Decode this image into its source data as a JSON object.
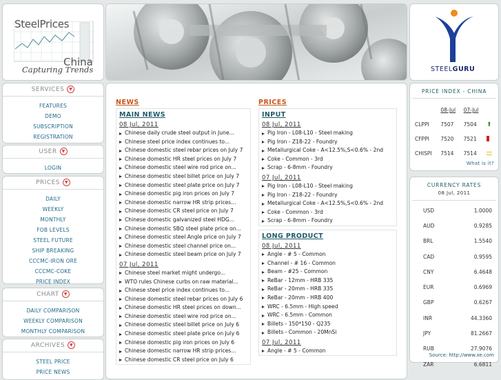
{
  "logo": {
    "brand_top": "SteelPrices",
    "brand_bottom": "China",
    "tagline": "Capturing Trends"
  },
  "partner": {
    "name_light": "STEEL",
    "name_bold": "GURU"
  },
  "sidebar": {
    "services": {
      "title": "SERVICES",
      "items": [
        "FEATURES",
        "DEMO",
        "SUBSCRIPTION",
        "REGISTRATION"
      ]
    },
    "user": {
      "title": "USER",
      "items": [
        "LOGIN"
      ]
    },
    "prices": {
      "title": "PRICES",
      "items": [
        "DAILY",
        "WEEKLY",
        "MONTHLY",
        "FOB LEVELS",
        "STEEL FUTURE",
        "SHIP BREAKING",
        "CCCMC-IRON ORE",
        "CCCMC-COKE",
        "PRICE INDEX"
      ]
    },
    "chart": {
      "title": "CHART",
      "items": [
        "DAILY COMPARISON",
        "WEEKLY COMPARISON",
        "MONTHLY COMPARISON"
      ]
    },
    "archives": {
      "title": "ARCHIVES",
      "items": [
        "STEEL PRICE",
        "PRICE NEWS"
      ]
    }
  },
  "news": {
    "heading": "NEWS",
    "main_title": "MAIN NEWS",
    "groups": [
      {
        "date": "08 Jul, 2011",
        "items": [
          "Chinese daily crude steel output in June...",
          "Chinese steel price index continues to...",
          "Chinese domestic steel rebar prices on July 7",
          "Chinese domestic HR steel prices on July 7",
          "Chinese domestic steel wire rod price on...",
          "Chinese domestic steel billet price on July 7",
          "Chinese domestic steel plate price on July 7",
          "Chinese domestic pig iron prices on July 7",
          "Chinese domestic narrow HR strip prices...",
          "Chinese domestic CR steel price on July 7",
          "Chinese domestic galvanized steel HDG...",
          "Chinese domestic SBQ steel plate price on...",
          "Chinese domestic steel Angle price on July 7",
          "Chinese domestic steel channel price on...",
          "Chinese domestic steel beam price on July 7"
        ]
      },
      {
        "date": "07 Jul, 2011",
        "items": [
          "Chinese steel market might undergo...",
          "WTO rules Chinese curbs on raw material...",
          "Chinese steel price index continues to...",
          "Chinese domestic steel rebar prices on July 6",
          "Chinese domestic HR steel prices on down...",
          "Chinese domestic steel wire rod price on...",
          "Chinese domestic steel billet price on July 6",
          "Chinese domestic steel plate price on July 6",
          "Chinese domestic pig iron prices on July 6",
          "Chinese domestic narrow HR strip prices...",
          "Chinese domestic CR steel price on July 6"
        ]
      }
    ]
  },
  "prices": {
    "heading": "PRICES",
    "input": {
      "title": "INPUT",
      "groups": [
        {
          "date": "08 Jul, 2011",
          "items": [
            "Pig Iron - L08-L10 - Steel making",
            "Pig Iron - Z18-22 - Foundry",
            "Metallurgical Coke - A<12.5%,S<0.6% - 2nd",
            "Coke - Common - 3rd",
            "Scrap - 6-8mm - Foundry"
          ]
        },
        {
          "date": "07 Jul, 2011",
          "items": [
            "Pig Iron - L08-L10 - Steel making",
            "Pig Iron - Z18-22 - Foundry",
            "Metallurgical Coke - A<12.5%,S<0.6% - 2nd",
            "Coke - Common - 3rd",
            "Scrap - 6-8mm - Foundry"
          ]
        }
      ]
    },
    "long": {
      "title": "LONG PRODUCT",
      "groups": [
        {
          "date": "08 Jul, 2011",
          "items": [
            "Angle - # 5 - Common",
            "Channel - # 16 - Common",
            "Beam - #25 - Common",
            "ReBar - 12mm - HRB 335",
            "ReBar - 20mm - HRB 335",
            "ReBar - 20mm - HRB 400",
            "WRC - 6.5mm - High speed",
            "WRC - 6.5mm - Common",
            "Billets - 150*150 - Q235",
            "Billets - Common - 20MnSi"
          ]
        },
        {
          "date": "07 Jul, 2011",
          "items": [
            "Angle - # 5 - Common"
          ]
        }
      ]
    }
  },
  "price_index": {
    "title": "PRICE INDEX - CHINA",
    "dates": [
      "08-Jul",
      "07-Jul"
    ],
    "rows": [
      {
        "name": "CLPPI",
        "v1": "7507",
        "v2": "7504",
        "trend": "up",
        "color": "#2a9a2a"
      },
      {
        "name": "CFPPI",
        "v1": "7520",
        "v2": "7521",
        "trend": "down",
        "color": "#d02020"
      },
      {
        "name": "CHISPI",
        "v1": "7514",
        "v2": "7514",
        "trend": "flat",
        "color": "#e0c030"
      }
    ],
    "link": "What is it?"
  },
  "currency": {
    "title": "CURRENCY RATES",
    "date": "08 Jul, 2011",
    "rows": [
      {
        "code": "USD",
        "rate": "1.0000"
      },
      {
        "code": "AUD",
        "rate": "0.9285"
      },
      {
        "code": "BRL",
        "rate": "1.5540"
      },
      {
        "code": "CAD",
        "rate": "0.9595"
      },
      {
        "code": "CNY",
        "rate": "6.4648"
      },
      {
        "code": "EUR",
        "rate": "0.6969"
      },
      {
        "code": "GBP",
        "rate": "0.6267"
      },
      {
        "code": "INR",
        "rate": "44.3360"
      },
      {
        "code": "JPY",
        "rate": "81.2667"
      },
      {
        "code": "RUB",
        "rate": "27.9076"
      },
      {
        "code": "ZAR",
        "rate": "6.6811"
      }
    ],
    "source": "Source: http://www.xe.com"
  }
}
